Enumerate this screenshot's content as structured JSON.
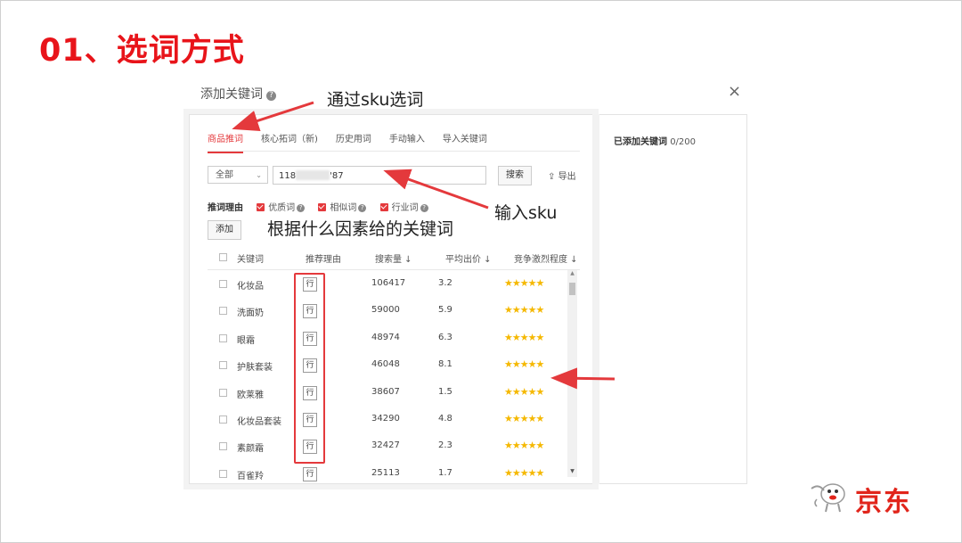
{
  "slide": {
    "title": "01、选词方式"
  },
  "dialog": {
    "title": "添加关键词",
    "help_icon": "?",
    "close_icon": "×",
    "tabs": [
      "商品推词",
      "核心拓词（新)",
      "历史用词",
      "手动输入",
      "导入关键词"
    ],
    "filter": {
      "select_value": "全部",
      "sku_prefix": "118",
      "sku_suffix": "'87",
      "search_label": "搜索",
      "export_label": "导出"
    },
    "reasons": {
      "label": "推词理由",
      "items": [
        "优质词",
        "相似词",
        "行业词"
      ]
    },
    "add_label": "添加",
    "table": {
      "headers": [
        "关键词",
        "推荐理由",
        "搜索量 ↓",
        "平均出价 ↓",
        "竞争激烈程度 ↓"
      ],
      "rows": [
        {
          "keyword": "化妆品",
          "reason": "行",
          "volume": "106417",
          "bid": "3.2",
          "stars": "★★★★★"
        },
        {
          "keyword": "洗面奶",
          "reason": "行",
          "volume": "59000",
          "bid": "5.9",
          "stars": "★★★★★"
        },
        {
          "keyword": "眼霜",
          "reason": "行",
          "volume": "48974",
          "bid": "6.3",
          "stars": "★★★★★"
        },
        {
          "keyword": "护肤套装",
          "reason": "行",
          "volume": "46048",
          "bid": "8.1",
          "stars": "★★★★★"
        },
        {
          "keyword": "欧莱雅",
          "reason": "行",
          "volume": "38607",
          "bid": "1.5",
          "stars": "★★★★★"
        },
        {
          "keyword": "化妆品套装",
          "reason": "行",
          "volume": "34290",
          "bid": "4.8",
          "stars": "★★★★★"
        },
        {
          "keyword": "素颜霜",
          "reason": "行",
          "volume": "32427",
          "bid": "2.3",
          "stars": "★★★★★"
        },
        {
          "keyword": "百雀羚",
          "reason": "行",
          "volume": "25113",
          "bid": "1.7",
          "stars": "★★★★★"
        }
      ]
    },
    "right_panel": {
      "label": "已添加关键词",
      "count": "0/200"
    }
  },
  "annotations": {
    "sku_tip": "通过sku选词",
    "input_tip": "输入sku",
    "factor_tip": "根据什么因素给的关键词"
  },
  "logo": {
    "text": "京东"
  },
  "colors": {
    "accent": "#e4393c",
    "title": "#e8141a",
    "star": "#f5b800"
  }
}
